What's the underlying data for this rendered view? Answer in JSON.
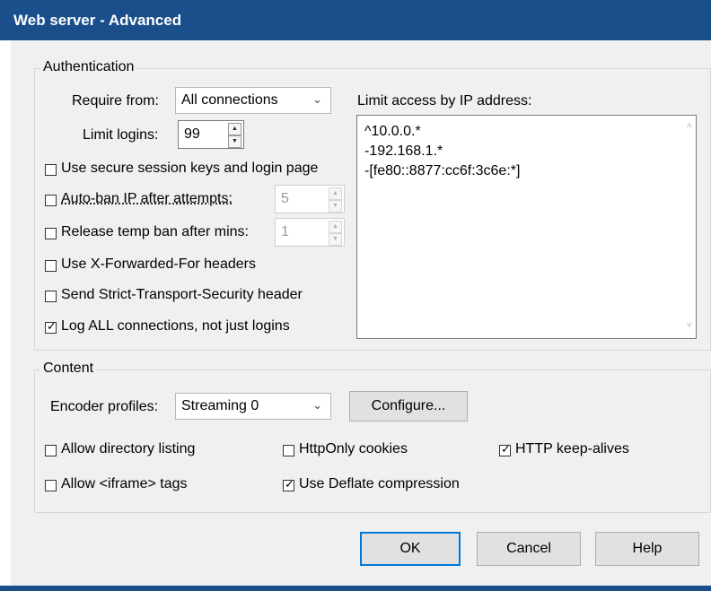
{
  "window": {
    "title": "Web server - Advanced"
  },
  "authentication": {
    "group_label": "Authentication",
    "require_from_label": "Require from:",
    "require_from_value": "All connections",
    "limit_logins_label": "Limit logins:",
    "limit_logins_value": "99",
    "secure_session_label": "Use secure session keys and login page",
    "secure_session_checked": false,
    "auto_ban_label": "Auto-ban IP after attempts:",
    "auto_ban_checked": false,
    "auto_ban_value": "5",
    "release_ban_label": "Release temp ban after mins:",
    "release_ban_checked": false,
    "release_ban_value": "1",
    "xff_label": "Use X-Forwarded-For headers",
    "xff_checked": false,
    "hsts_label": "Send Strict-Transport-Security header",
    "hsts_checked": false,
    "log_all_label": "Log ALL connections, not just logins",
    "log_all_checked": true,
    "ip_limit_label": "Limit access by IP address:",
    "ip_lines": [
      "^10.0.0.*",
      "-192.168.1.*",
      "-[fe80::8877:cc6f:3c6e:*]"
    ]
  },
  "content": {
    "group_label": "Content",
    "encoder_label": "Encoder profiles:",
    "encoder_value": "Streaming 0",
    "configure_label": "Configure...",
    "dir_listing_label": "Allow directory listing",
    "dir_listing_checked": false,
    "httponly_label": "HttpOnly cookies",
    "httponly_checked": false,
    "keepalive_label": "HTTP keep-alives",
    "keepalive_checked": true,
    "iframe_label": "Allow <iframe> tags",
    "iframe_checked": false,
    "deflate_label": "Use Deflate compression",
    "deflate_checked": true
  },
  "buttons": {
    "ok": "OK",
    "cancel": "Cancel",
    "help": "Help"
  },
  "colors": {
    "titlebar": "#1a4f8b",
    "dialog_bg": "#f0f0f0",
    "default_button_border": "#0078d7"
  }
}
